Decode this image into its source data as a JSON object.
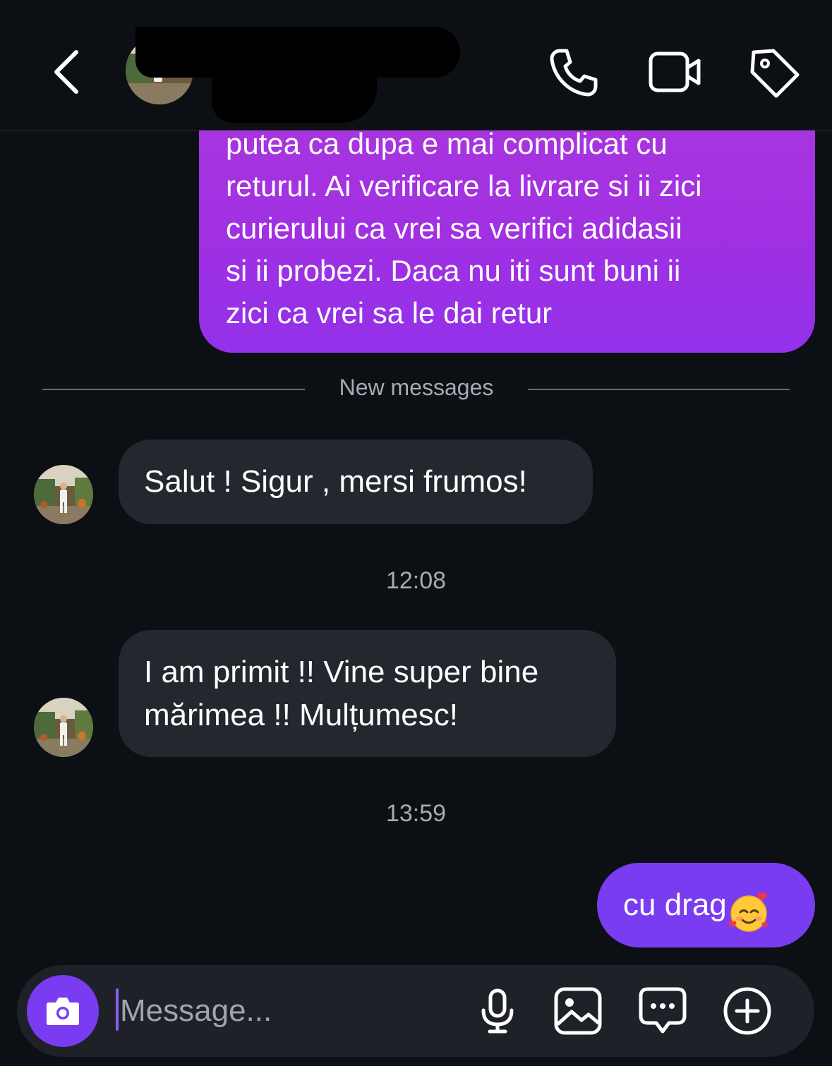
{
  "header": {
    "contact_name": "",
    "status": "",
    "icons": [
      "back-icon",
      "phone-icon",
      "video-icon",
      "tag-icon"
    ]
  },
  "messages": {
    "outgoing_1": "putea ca dupa e mai complicat cu\nreturul. Ai verificare la livrare si ii zici\ncurierului ca vrei sa verifici adidasii\nsi ii probezi. Daca nu iti sunt buni ii\nzici ca vrei sa le dai retur",
    "new_messages_label": "New messages",
    "incoming_1": "Salut ! Sigur , mersi frumos!",
    "time_1": "12:08",
    "incoming_2": "I am primit !! Vine super bine\nmărimea !! Mulțumesc!",
    "time_2": "13:59",
    "outgoing_2": "cu drag",
    "outgoing_2_emoji": "smiling-face-with-hearts"
  },
  "composer": {
    "placeholder": "Message...",
    "icons": [
      "camera-icon",
      "microphone-icon",
      "gallery-icon",
      "sticker-icon",
      "plus-icon"
    ]
  },
  "colors": {
    "background": "#0c0f14",
    "outgoing_bubble_top": "#ab36de",
    "outgoing_bubble_bottom": "#9331ea",
    "outgoing_bubble_2": "#7a3cf1",
    "incoming_bubble": "#24272e",
    "muted_text": "#a7abb2",
    "camera_button": "#7a3cf1"
  }
}
